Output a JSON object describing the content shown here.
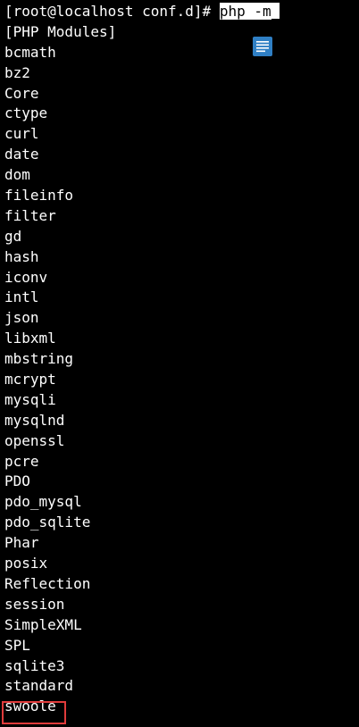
{
  "terminal": {
    "prompt": "[root@localhost conf.d]# ",
    "command": "php -m",
    "header": "[PHP Modules]",
    "modules": [
      "bcmath",
      "bz2",
      "Core",
      "ctype",
      "curl",
      "date",
      "dom",
      "fileinfo",
      "filter",
      "gd",
      "hash",
      "iconv",
      "intl",
      "json",
      "libxml",
      "mbstring",
      "mcrypt",
      "mysqli",
      "mysqlnd",
      "openssl",
      "pcre",
      "PDO",
      "pdo_mysql",
      "pdo_sqlite",
      "Phar",
      "posix",
      "Reflection",
      "session",
      "SimpleXML",
      "SPL",
      "sqlite3",
      "standard",
      "swoole"
    ],
    "highlighted_module": "swoole"
  },
  "icons": {
    "floating": "document-icon"
  },
  "colors": {
    "background": "#000000",
    "text": "#ffffff",
    "highlight_border": "#e03b3b",
    "icon": "#2f7fc4"
  }
}
